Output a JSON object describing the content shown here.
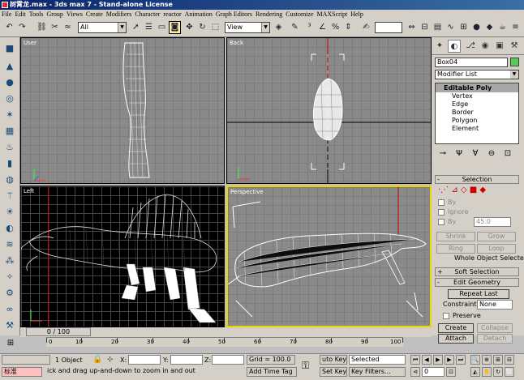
{
  "title": "树霄龙.max - 3ds max 7 - Stand-alone License",
  "menu": [
    "File",
    "Edit",
    "Tools",
    "Group",
    "Views",
    "Create",
    "Modifiers",
    "Character",
    "reactor",
    "Animation",
    "Graph Editors",
    "Rendering",
    "Customize",
    "MAXScript",
    "Help"
  ],
  "toolbar": {
    "selection_filter": "All",
    "ref_coord": "View",
    "named_sel": ""
  },
  "viewports": {
    "user": "User",
    "back": "Back",
    "left": "Left",
    "perspective": "Perspective"
  },
  "cmd": {
    "object_name": "Box04",
    "object_color": "#5cc85c",
    "modifier_list": "Modifier List",
    "stack_header": "Editable Poly",
    "stack_items": [
      "Vertex",
      "Edge",
      "Border",
      "Polygon",
      "Element"
    ],
    "selection_title": "Selection",
    "by_vertex": "By",
    "ignore": "Ignore",
    "by_angle": "By",
    "angle_value": "45.0",
    "shrink": "Shrink",
    "grow": "Grow",
    "ring": "Ring",
    "loop": "Loop",
    "whole_selected": "Whole Object Selected",
    "soft_selection": "Soft Selection",
    "edit_geometry": "Edit Geometry",
    "repeat_last": "Repeat Last",
    "constraints_label": "Constraints:",
    "constraints_value": "None",
    "preserve": "Preserve",
    "create": "Create",
    "collapse": "Collapse",
    "attach": "Attach",
    "detach": "Detach"
  },
  "timeline": {
    "slider": "0 / 100",
    "ticks": [
      "0",
      "10",
      "20",
      "30",
      "40",
      "50",
      "60",
      "70",
      "80",
      "90",
      "100"
    ]
  },
  "status": {
    "objects": "1 Object",
    "x_label": "X:",
    "y_label": "Y:",
    "z_label": "Z:",
    "grid": "Grid = 100.0",
    "auto_key": "uto Key",
    "selected": "Selected",
    "set_key": "Set Key",
    "key_filters": "Key Filters...",
    "prompt": "ick and drag up-and-down to zoom in and out",
    "add_time_tag": "Add Time Tag",
    "mode": "标准",
    "frame": "0"
  }
}
